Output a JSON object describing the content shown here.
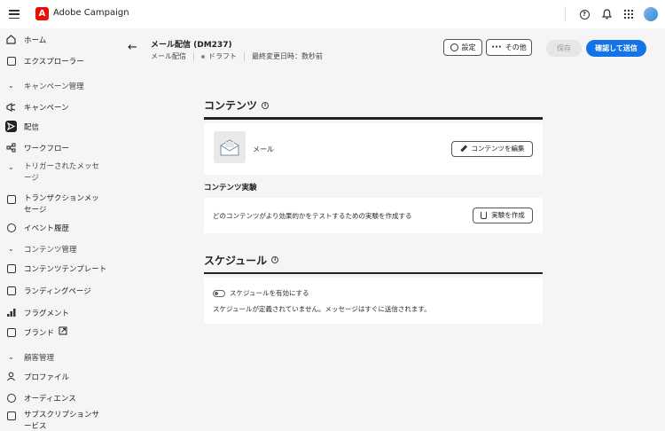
{
  "app": {
    "name": "Adobe Campaign",
    "logo_letter": "A",
    "brand_color": "#eb1000"
  },
  "topbar": {
    "icons": [
      "menu-icon",
      "help-icon",
      "bell-icon",
      "app-switcher-icon",
      "avatar"
    ]
  },
  "sidebar": {
    "items": [
      {
        "label": "ホーム",
        "icon": "home-icon",
        "kind": "item"
      },
      {
        "label": "エクスプローラー",
        "icon": "explorer-icon",
        "kind": "item"
      },
      {
        "label": "キャンペーン管理",
        "icon": "chevron-down-icon",
        "kind": "section"
      },
      {
        "label": "キャンペーン",
        "icon": "megaphone-icon",
        "kind": "item"
      },
      {
        "label": "配信",
        "icon": "send-icon",
        "kind": "item",
        "active": true
      },
      {
        "label": "ワークフロー",
        "icon": "workflow-icon",
        "kind": "item"
      },
      {
        "label": "トリガーされたメッセージ",
        "icon": "chevron-down-icon",
        "kind": "section"
      },
      {
        "label": "トランザクションメッセージ",
        "icon": "transaction-icon",
        "kind": "item"
      },
      {
        "label": "イベント履歴",
        "icon": "event-history-icon",
        "kind": "item"
      },
      {
        "label": "コンテンツ管理",
        "icon": "chevron-down-icon",
        "kind": "section"
      },
      {
        "label": "コンテンツテンプレート",
        "icon": "template-icon",
        "kind": "item"
      },
      {
        "label": "ランディングページ",
        "icon": "landing-page-icon",
        "kind": "item"
      },
      {
        "label": "フラグメント",
        "icon": "fragment-icon",
        "kind": "item"
      },
      {
        "label": "ブランド",
        "icon": "brand-icon",
        "kind": "item",
        "external": true
      },
      {
        "label": "顧客管理",
        "icon": "chevron-down-icon",
        "kind": "section"
      },
      {
        "label": "プロファイル",
        "icon": "profile-icon",
        "kind": "item"
      },
      {
        "label": "オーディエンス",
        "icon": "audience-icon",
        "kind": "item"
      },
      {
        "label": "サブスクリプションサービス",
        "icon": "subscription-icon",
        "kind": "item"
      }
    ]
  },
  "header": {
    "title": "メール配信 (DM237)",
    "channel": "メール配信",
    "status": "ドラフト",
    "last_modified": "最終変更日時：数秒前",
    "settings_label": "設定",
    "more_label": "その他",
    "save_label": "保存",
    "confirm_label": "確認して送信",
    "primary_color": "#1473e6"
  },
  "content": {
    "title": "コンテンツ",
    "email_label": "メール",
    "edit_content_label": "コンテンツを編集",
    "experiment_title": "コンテンツ実験",
    "experiment_desc": "どのコンテンツがより効果的かをテストするための実験を作成する",
    "create_experiment_label": "実験を作成"
  },
  "schedule": {
    "title": "スケジュール",
    "toggle_label": "スケジュールを有効にする",
    "toggle_on": false,
    "note": "スケジュールが定義されていません。メッセージはすぐに送信されます。"
  }
}
